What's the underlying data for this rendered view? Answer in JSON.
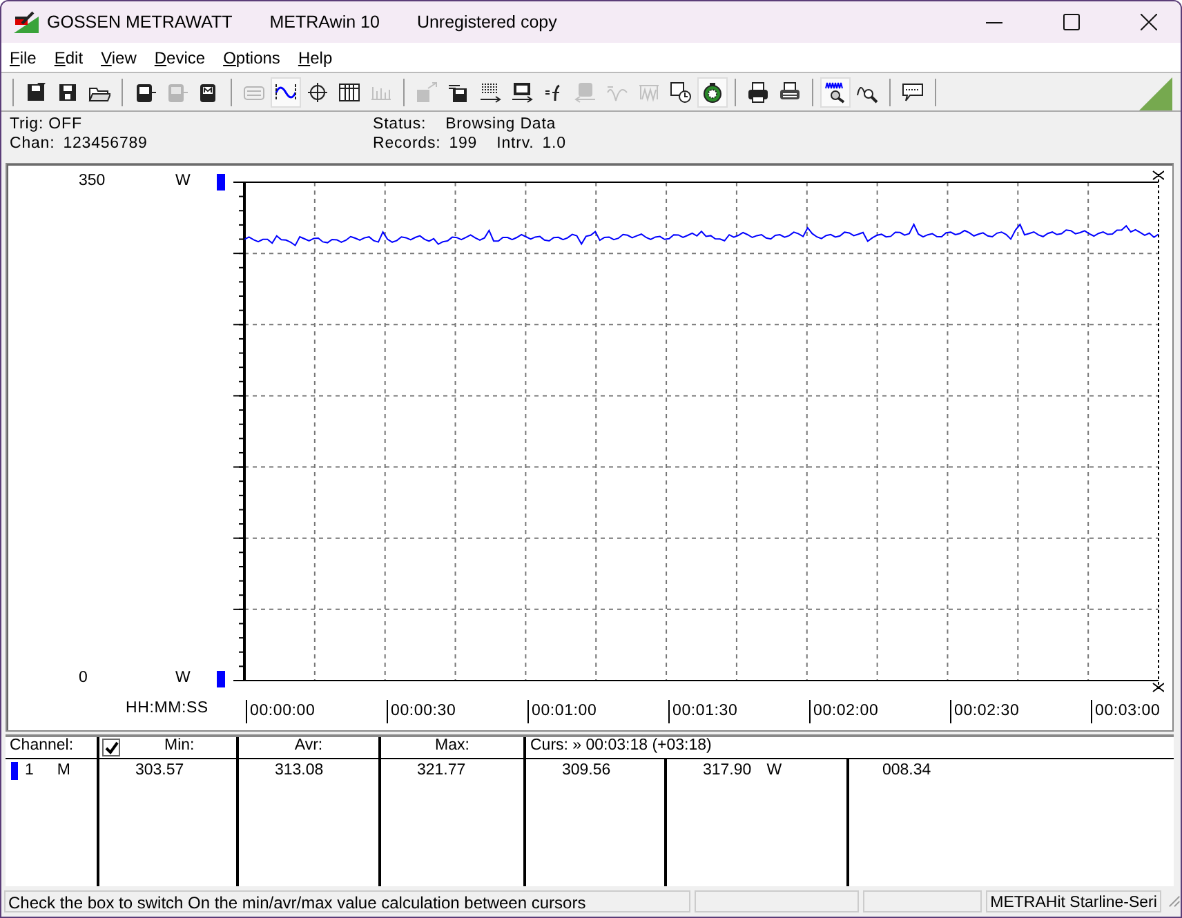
{
  "window": {
    "title_parts": [
      "GOSSEN METRAWATT",
      "METRAwin 10",
      "Unregistered copy"
    ]
  },
  "menu": [
    "File",
    "Edit",
    "View",
    "Device",
    "Options",
    "Help"
  ],
  "toolbar": [
    [
      {
        "pressed": false,
        "disabled": false
      },
      {
        "pressed": false,
        "disabled": false
      },
      {
        "pressed": false,
        "disabled": false
      }
    ],
    [
      {
        "pressed": false,
        "disabled": false
      },
      {
        "pressed": false,
        "disabled": true
      },
      {
        "pressed": false,
        "disabled": false
      }
    ],
    [
      {
        "pressed": false,
        "disabled": true
      },
      {
        "pressed": true,
        "disabled": false
      },
      {
        "pressed": false,
        "disabled": false
      },
      {
        "pressed": false,
        "disabled": false
      },
      {
        "pressed": false,
        "disabled": true
      }
    ],
    [
      {
        "pressed": false,
        "disabled": true
      },
      {
        "pressed": false,
        "disabled": false
      },
      {
        "pressed": false,
        "disabled": false
      },
      {
        "pressed": false,
        "disabled": false
      },
      {
        "pressed": false,
        "disabled": false
      },
      {
        "pressed": false,
        "disabled": true
      },
      {
        "pressed": false,
        "disabled": true
      },
      {
        "pressed": false,
        "disabled": true
      },
      {
        "pressed": false,
        "disabled": false
      },
      {
        "pressed": true,
        "disabled": false
      }
    ],
    [
      {
        "pressed": false,
        "disabled": false
      },
      {
        "pressed": false,
        "disabled": false
      }
    ],
    [
      {
        "pressed": true,
        "disabled": false
      },
      {
        "pressed": false,
        "disabled": false
      }
    ],
    [
      {
        "pressed": false,
        "disabled": false
      }
    ]
  ],
  "info": {
    "trig": "Trig: OFF",
    "chan_label": "Chan:",
    "chan": "123456789",
    "status_label": "Status:",
    "status": "Browsing Data",
    "records_label": "Records:",
    "records": "199",
    "interval_label": "Intrv.",
    "interval": "1.0"
  },
  "plot": {
    "y_max": "350",
    "y_min": "0",
    "unit_top": "W",
    "unit_bottom": "W",
    "time_label": "HH:MM:SS",
    "time_ticks": [
      "00:00:00",
      "00:00:30",
      "00:01:00",
      "00:01:30",
      "00:02:00",
      "00:02:30",
      "00:03:00"
    ]
  },
  "table": {
    "channel_header": "Channel:",
    "calc_checked": true,
    "min_header": "Min:",
    "avr_header": "Avr:",
    "max_header": "Max:",
    "cursor_header": "Curs: » 00:03:18 (+03:18)",
    "rows": [
      {
        "channel": "1",
        "mode": "M",
        "color": "#0000ff",
        "min": "303.57",
        "avr": "313.08",
        "max": "321.77",
        "cursor_1": "309.56",
        "cursor_2": "317.90",
        "unit": "W",
        "cursor_3": "008.34"
      }
    ]
  },
  "status_bar": {
    "hint": "Check the box to switch On the min/avr/max value calculation between cursors",
    "device": "METRAHit Starline-Seri"
  }
}
